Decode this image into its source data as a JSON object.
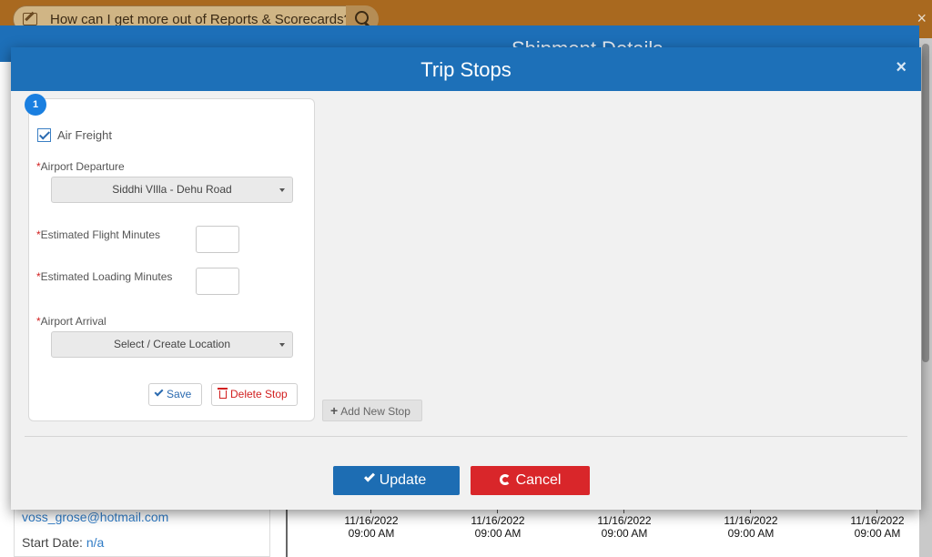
{
  "help_bar": {
    "question": "How can I get more out of Reports & Scorecards?",
    "close_glyph": "×"
  },
  "background": {
    "header_title": "Shipment Details",
    "email": "voss_grose@hotmail.com",
    "start_date_label": "Start Date:",
    "start_date_value": "n/a",
    "timeline": [
      {
        "date": "11/16/2022",
        "time": "09:00 AM"
      },
      {
        "date": "11/16/2022",
        "time": "09:00 AM"
      },
      {
        "date": "11/16/2022",
        "time": "09:00 AM"
      },
      {
        "date": "11/16/2022",
        "time": "09:00 AM"
      },
      {
        "date": "11/16/2022",
        "time": "09:00 AM"
      }
    ]
  },
  "modal": {
    "title": "Trip Stops",
    "close_glyph": "×",
    "stop": {
      "number": "1",
      "air_freight_label": "Air Freight",
      "air_freight_checked": true,
      "required_mark": "*",
      "airport_departure_label": "Airport Departure",
      "airport_departure_value": "Siddhi VIlla - Dehu Road",
      "flight_minutes_label": "Estimated Flight Minutes",
      "flight_minutes_value": "",
      "loading_minutes_label": "Estimated Loading Minutes",
      "loading_minutes_value": "",
      "airport_arrival_label": "Airport Arrival",
      "airport_arrival_value": "Select / Create Location",
      "save_label": "Save",
      "delete_label": "Delete Stop"
    },
    "add_stop_label": "Add New Stop",
    "update_label": "Update",
    "cancel_label": "Cancel"
  },
  "colors": {
    "primary": "#1d70b8",
    "danger": "#d9262a",
    "top_bar": "#a9691f",
    "badge": "#1a7fe0"
  }
}
